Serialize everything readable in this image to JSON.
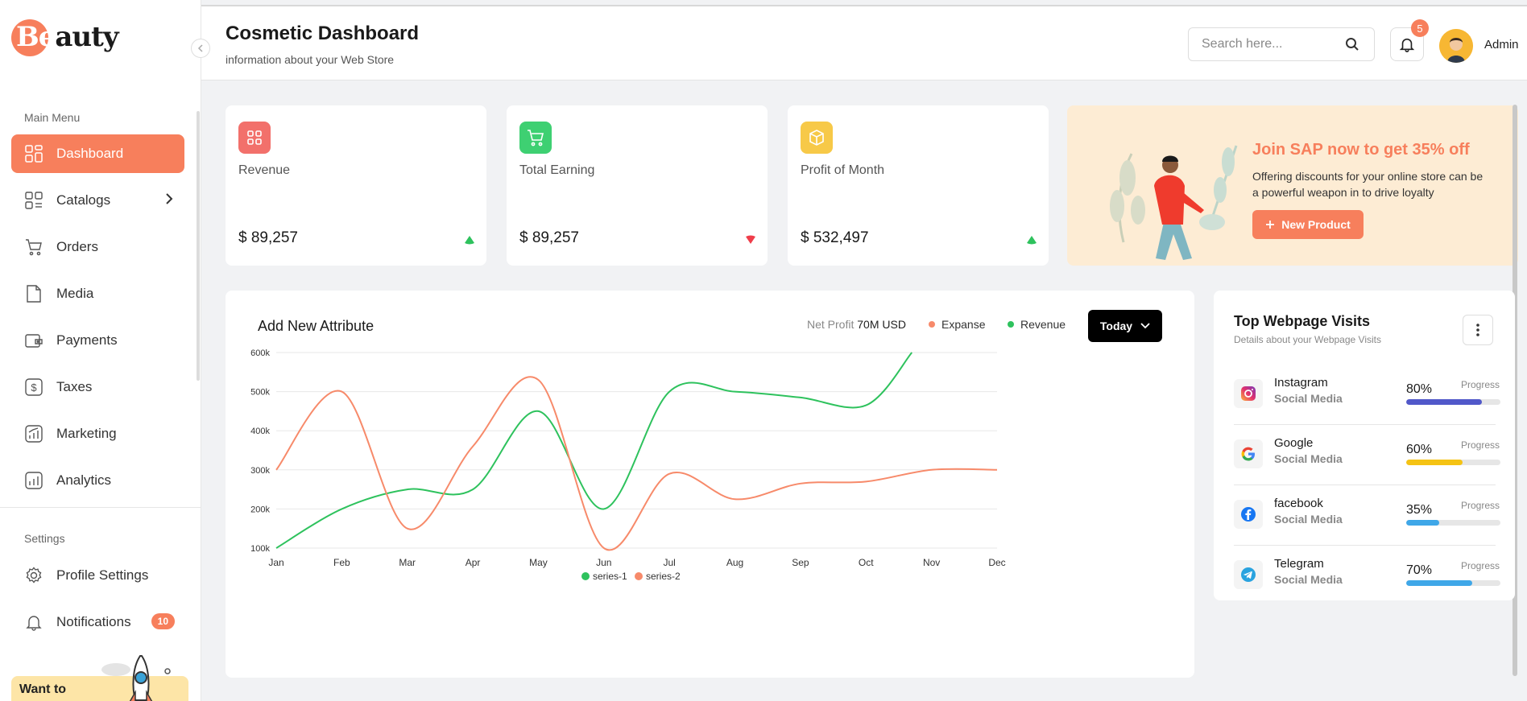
{
  "brand": {
    "logo_text": "Beauty",
    "accent": "#f77f5c"
  },
  "sidebar": {
    "main_menu_label": "Main Menu",
    "items": [
      {
        "label": "Dashboard",
        "icon": "dashboard-icon",
        "active": true
      },
      {
        "label": "Catalogs",
        "icon": "catalog-icon",
        "has_submenu": true
      },
      {
        "label": "Orders",
        "icon": "cart-icon"
      },
      {
        "label": "Media",
        "icon": "file-icon"
      },
      {
        "label": "Payments",
        "icon": "wallet-icon"
      },
      {
        "label": "Taxes",
        "icon": "dollar-icon"
      },
      {
        "label": "Marketing",
        "icon": "marketing-chart-icon"
      },
      {
        "label": "Analytics",
        "icon": "analytics-icon"
      }
    ],
    "settings_label": "Settings",
    "settings_items": [
      {
        "label": "Profile Settings",
        "icon": "gear-icon"
      },
      {
        "label": "Notifications",
        "icon": "bell-icon",
        "badge": "10"
      }
    ],
    "promo_text": "Want to"
  },
  "header": {
    "title": "Cosmetic Dashboard",
    "subtitle": "information about your Web Store",
    "search_placeholder": "Search here...",
    "notification_count": "5",
    "user_name": "Admin"
  },
  "stats": [
    {
      "label": "Revenue",
      "value": "$ 89,257",
      "trend": "up",
      "icon": "grid-icon",
      "color": "#f2706b"
    },
    {
      "label": "Total Earning",
      "value": "$ 89,257",
      "trend": "down",
      "icon": "cart-icon",
      "color": "#3ed072"
    },
    {
      "label": "Profit of Month",
      "value": "$ 532,497",
      "trend": "up",
      "icon": "box-icon",
      "color": "#f7c948"
    }
  ],
  "promo": {
    "heading": "Join SAP now to get 35% off",
    "description": "Offering discounts for your online store can be a powerful weapon in to drive loyalty",
    "button_label": "New Product"
  },
  "chart_card": {
    "title": "Add New Attribute",
    "net_profit_label": "Net Profit",
    "net_profit_value": "70M USD",
    "legend_expanse": "Expanse",
    "legend_revenue": "Revenue",
    "period_button": "Today"
  },
  "chart_data": {
    "type": "line",
    "categories": [
      "Jan",
      "Feb",
      "Mar",
      "Apr",
      "May",
      "Jun",
      "Jul",
      "Aug",
      "Sep",
      "Oct",
      "Nov",
      "Dec"
    ],
    "ylim": [
      100000,
      600000
    ],
    "y_ticks": [
      "100k",
      "200k",
      "300k",
      "400k",
      "500k",
      "600k"
    ],
    "grid": true,
    "legend_position": "bottom",
    "series": [
      {
        "name": "series-1",
        "color": "#2ec25d",
        "x": [
          0,
          1,
          2,
          3,
          4,
          5,
          6,
          7,
          8,
          9,
          9.7
        ],
        "values": [
          100000,
          200000,
          250000,
          250000,
          450000,
          200000,
          500000,
          500000,
          485000,
          465000,
          600000
        ]
      },
      {
        "name": "series-2",
        "color": "#f78a6a",
        "x": [
          0,
          1,
          2,
          3,
          4,
          5,
          6,
          7,
          8,
          9,
          10,
          11
        ],
        "values": [
          300000,
          500000,
          150000,
          360000,
          530000,
          100000,
          290000,
          225000,
          265000,
          270000,
          300000,
          300000
        ]
      }
    ]
  },
  "visits": {
    "title": "Top Webpage Visits",
    "subtitle": "Details about your Webpage Visits",
    "progress_label": "Progress",
    "rows": [
      {
        "name": "Instagram",
        "category": "Social Media",
        "percent": "80%",
        "progress": 0.8,
        "color": "#5158c9",
        "icon": "instagram-icon"
      },
      {
        "name": "Google",
        "category": "Social Media",
        "percent": "60%",
        "progress": 0.6,
        "color": "#f5c314",
        "icon": "google-icon"
      },
      {
        "name": "facebook",
        "category": "Social Media",
        "percent": "35%",
        "progress": 0.35,
        "color": "#3fa7e8",
        "icon": "facebook-icon"
      },
      {
        "name": "Telegram",
        "category": "Social Media",
        "percent": "70%",
        "progress": 0.7,
        "color": "#3fa7e8",
        "icon": "telegram-icon"
      }
    ]
  }
}
